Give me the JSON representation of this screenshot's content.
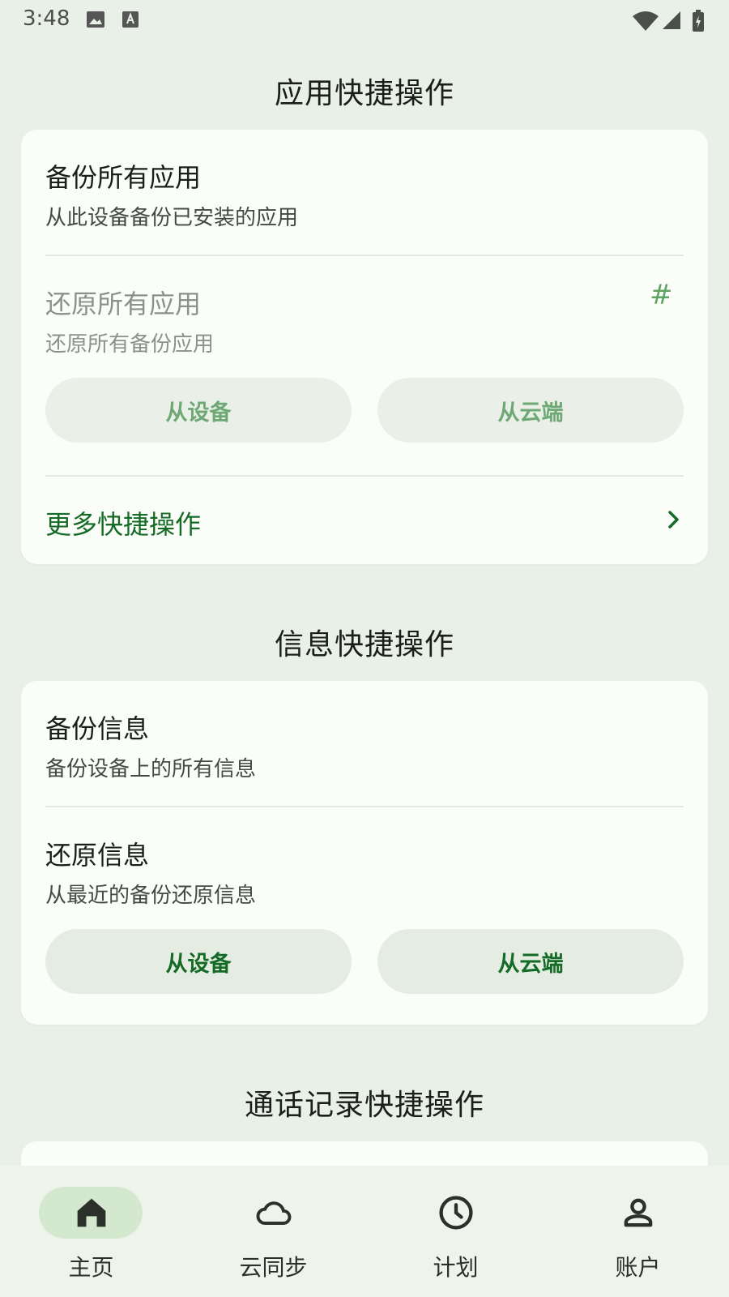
{
  "status": {
    "time": "3:48"
  },
  "sections": {
    "apps": {
      "title": "应用快捷操作",
      "backup_title": "备份所有应用",
      "backup_sub": "从此设备备份已安装的应用",
      "restore_title": "还原所有应用",
      "restore_sub": "还原所有备份应用",
      "restore_badge": "#",
      "from_device": "从设备",
      "from_cloud": "从云端",
      "more": "更多快捷操作"
    },
    "messages": {
      "title": "信息快捷操作",
      "backup_title": "备份信息",
      "backup_sub": "备份设备上的所有信息",
      "restore_title": "还原信息",
      "restore_sub": "从最近的备份还原信息",
      "from_device": "从设备",
      "from_cloud": "从云端"
    },
    "calls": {
      "title": "通话记录快捷操作"
    }
  },
  "nav": {
    "items": [
      {
        "label": "主页",
        "icon": "home-icon",
        "active": true
      },
      {
        "label": "云同步",
        "icon": "cloud-icon",
        "active": false
      },
      {
        "label": "计划",
        "icon": "clock-icon",
        "active": false
      },
      {
        "label": "账户",
        "icon": "person-icon",
        "active": false
      }
    ]
  },
  "colors": {
    "background": "#e9f0e7",
    "card": "#fbfdf9",
    "accent": "#136b25",
    "pill": "#e5ede3",
    "nav_indicator": "#d4e8cf"
  }
}
